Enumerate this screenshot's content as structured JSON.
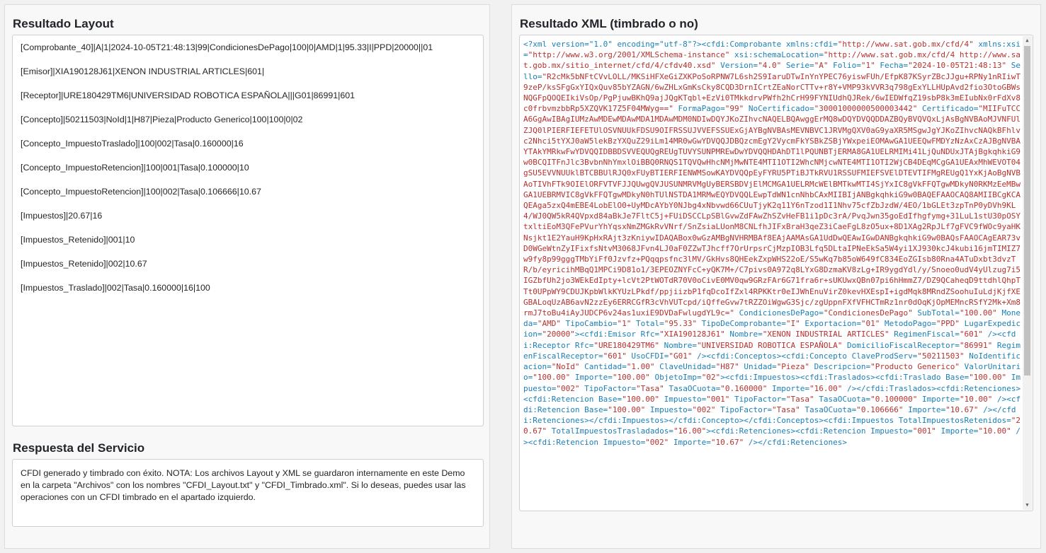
{
  "left_panel": {
    "layout_title": "Resultado Layout",
    "layout_lines": [
      "[Comprobante_40]|A|1|2024-10-05T21:48:13|99|CondicionesDePago|100|0|AMD|1|95.33|I|PPD|20000||01",
      "[Emisor]|XIA190128J61|XENON INDUSTRIAL ARTICLES|601|",
      "[Receptor]|URE180429TM6|UNIVERSIDAD ROBOTICA ESPAÑOLA|||G01|86991|601",
      "[Concepto]|50211503|NoId|1|H87|Pieza|Producto Generico|100|100|0|02",
      "[Concepto_ImpuestoTraslado]|100|002|Tasa|0.160000|16",
      "[Concepto_ImpuestoRetencion]|100|001|Tasa|0.100000|10",
      "[Concepto_ImpuestoRetencion]|100|002|Tasa|0.106666|10.67",
      "[Impuestos]|20.67|16",
      "[Impuestos_Retenido]|001|10",
      "[Impuestos_Retenido]|002|10.67",
      "[Impuestos_Traslado]|002|Tasa|0.160000|16|100"
    ],
    "service_title": "Respuesta del Servicio",
    "service_message": "CFDI generado y timbrado con éxito. NOTA: Los archivos Layout y XML se guardaron internamente en este Demo en la carpeta \"Archivos\" con los nombres \"CFDI_Layout.txt\" y \"CFDI_Timbrado.xml\". Si lo deseas, puedes usar las operaciones con un CFDI timbrado en el apartado izquierdo."
  },
  "right_panel": {
    "xml_title": "Resultado XML (timbrado o no)",
    "xml_tokens": [
      [
        "t",
        "<?xml version=\"1.0\" encoding=\"utf-8\"?><cfdi:Comprobante xmlns:cfdi="
      ],
      [
        "v",
        "\"http://www.sat.gob.mx/cfd/4\""
      ],
      [
        "t",
        " xmlns:xsi="
      ],
      [
        "v",
        "\"http://www.w3.org/2001/XMLSchema-instance\""
      ],
      [
        "t",
        " xsi:schemaLocation="
      ],
      [
        "v",
        "\"http://www.sat.gob.mx/cfd/4 http://www.sat.gob.mx/sitio_internet/cfd/4/cfdv40.xsd\""
      ],
      [
        "t",
        " Version="
      ],
      [
        "v",
        "\"4.0\""
      ],
      [
        "t",
        " Serie="
      ],
      [
        "v",
        "\"A\""
      ],
      [
        "t",
        " Folio="
      ],
      [
        "v",
        "\"1\""
      ],
      [
        "t",
        " Fecha="
      ],
      [
        "v",
        "\"2024-10-05T21:48:13\""
      ],
      [
        "t",
        " Sello="
      ],
      [
        "v",
        "\"R2cMk5bNFtCVvLOLL/MKSiHFXeGiZXKPoSoRPNW7L6sh2S9IaruDTwInYnYPEC76yiswFUh/EfpK87KSyrZBcJJgu+RPNy1nRIiwT9zeP/ksSFgGxYIQxQuv85bYZAGN/6wZHLxGmKsCky8CQD3DrnICrtZEaNorCTTv+r8Y+VMP93kVVR3q798gExYLLHUpAvd2fio3OtoGBWsNQGFpQOQEIkiVsOp/PgPjuwBKhQ9ajJQgKTqbl+EzVi0TMkkdrvPWfh2hCrH99FYNIUdhQJRek/6wIEDWfqZ19sbP8k3mEIubNx0rFdXv8c0frbvmzbbRp5XZQVK17Z5F04MWyg==\""
      ],
      [
        "t",
        " FormaPago="
      ],
      [
        "v",
        "\"99\""
      ],
      [
        "t",
        " NoCertificado="
      ],
      [
        "v",
        "\"30001000000500003442\""
      ],
      [
        "t",
        " Certificado="
      ],
      [
        "v",
        "\"MIIFuTCCA6GgAwIBAgIUMzAwMDEwMDAwMDA1MDAwMDM0NDIwDQYJKoZIhvcNAQELBQAwggErMQ8wDQYDVQQDDAZBQyBVQVQxLjAsBgNVBAoMJVNFUlZJQ0lPIERFIEFETUlOSVNUUkFDSU9OIFRSSUJVVEFSSUExGjAYBgNVBAsMEVNBVC1JRVMgQXV0aG9yaXR5MSgwJgYJKoZIhvcNAQkBFhlvc2Nhci5tYXJ0aW5lekBzYXQuZ29iLm14MR0wGwYDVQQJDBQzcmEgY2VycmFkYSBkZSBjYWxpeiEOMAwGA1UEEQwFMDYzNzAxCzAJBgNVBAYTAkYMRkwFwYDVQQIDBBDSVVEQUQgREUgTUVYSUNPMREwDwYDVQQHDAhDT1lPQUNBTjERMA8GA1UELRMIMi41LjQuNDUxJTAjBgkqhkiG9w0BCQITFnJlc3BvbnNhYmxlOiBBQ0RNQS1TQVQwHhcNMjMwNTE4MTI1OTI2WhcNMjcwNTE4MTI1OTI2WjCB4DEqMCgGA1UEAxMhWEVOT04gSU5EVVNUUklBTCBBUlRJQ0xFUyBTIERFIENWMSowKAYDVQQpEyFYRU5PTiBJTkRVU1RSSUFMIEFSVElDTEVTIFMgREUgQ1YxKjAoBgNVBAoTIVhFTk9OIElORFVTVFJJQUwgQVJUSUNMRVMgUyBERSBDVjElMCMGA1UELRMcWElBMTkwMTI4SjYxIC8gVkFFQTgwMDkyN0RKMzEeMBwGA1UEBRMVIC8gVkFFQTgwMDkyN0hTUlNSTDA1MRMwEQYDVQQLEwpTdWN1cnNhbCAxMIIBIjANBgkqhkiG9w0BAQEFAAOCAQ8AMIIBCgKCAQEAga5zxQ4mEBE4LobElO0+UyMDcAYbY0NJbg4xNbvwd66CUuTjyK2q11Y6nTzod1I1Nhv75cfZbJzdW/4EO/1bGLEt3zpTnP0yDVh9KL4/WJ0QW5kR4QVpxd84aBkJe7FltC5j+FUiDSCCLpSBlGvwZdFAwZhSZvHeFB1i1pDc3rA/PvqJwn35goEdIfhgfymg+31LuL1stU30pOSYtxltiEoM3QFePVurYhYqsxNmZMGkRvVNrf/SnZsiaLUonM8CNLfhJIFxBraH3qeZ3iCaeFgL8zO5ux+8D1XAg2RpJLf7gFVC9fWOc9yaHKNsjkt1E2YauH9KpHxRAjt3zKniywIDAQABox0wGzAMBgNVHRMBAf8EAjAAMAsGA1UdDwQEAwIGwDANBgkqhkiG9w0BAQsFAAOCAgEAR73vD0WGeWtnZyIFixfsNtvM3068JFvn4LJ0aF0ZZwTJhcff7OrUrpsrCjMzpIOB3Lfq5DLtaIPNeEkSa5W4yi1XJ930kcJ4kubi16jmTIMIZ7w9fy8p99gggTMbYiFf0Jzvfz+PQqqpsfnc3lMV/GkHvs8QHEekZxpWHS22oE/S5wKq7b85oW649fC834EoZGIsb80Rna4ATuDxbt3dvzTR/b/eyricihMBqQ1MPCi9D81o1/3EPEOZNYFcC+yQK7M+/C7pivs0A972q8LYxG8DzmaKV8zLg+IR9ygdYdl/y/Snoeo0udV4yUlzug7i5IGZbfUh2jo3WEkEdIpty+lcVt2PtWOTdR70V0oCivE0MV0qw9GRzFAr6G71fra6r+sUKUwxQBn07pi6hHmmZ7/DZ9QCaheqD9ttdhlQhpTTt0UPpWY9CDUJKpbWlkKYUzLPkdf/ppjiizbP1fqDcoIfZxl4RPKKtr0eIJWhEnuVirZ0kevHXEspI+igdMqk8MRndZSoohuIuLdjKjfXEGBALoqUzAB6avN2zzEy6ERRCGfR3cVhVUTcpd/iQffeGvw7tRZZOiWgwG3Sjc/zgUppnFXfVFHCTmRz1nr0dOqKjOpMEMncRSfY2Mk+Xm8rmJ7toBu4iAyJUDCP6v24as1uxiE9DVDaFwlugdYL9c=\""
      ],
      [
        "t",
        " CondicionesDePago="
      ],
      [
        "v",
        "\"CondicionesDePago\""
      ],
      [
        "t",
        " SubTotal="
      ],
      [
        "v",
        "\"100.00\""
      ],
      [
        "t",
        " Moneda="
      ],
      [
        "v",
        "\"AMD\""
      ],
      [
        "t",
        " TipoCambio="
      ],
      [
        "v",
        "\"1\""
      ],
      [
        "t",
        " Total="
      ],
      [
        "v",
        "\"95.33\""
      ],
      [
        "t",
        " TipoDeComprobante="
      ],
      [
        "v",
        "\"I\""
      ],
      [
        "t",
        " Exportacion="
      ],
      [
        "v",
        "\"01\""
      ],
      [
        "t",
        " MetodoPago="
      ],
      [
        "v",
        "\"PPD\""
      ],
      [
        "t",
        " LugarExpedicion="
      ],
      [
        "v",
        "\"20000\""
      ],
      [
        "t",
        "><cfdi:Emisor Rfc="
      ],
      [
        "v",
        "\"XIA190128J61\""
      ],
      [
        "t",
        " Nombre="
      ],
      [
        "v",
        "\"XENON INDUSTRIAL ARTICLES\""
      ],
      [
        "t",
        " RegimenFiscal="
      ],
      [
        "v",
        "\"601\""
      ],
      [
        "t",
        " /><cfdi:Receptor Rfc="
      ],
      [
        "v",
        "\"URE180429TM6\""
      ],
      [
        "t",
        " Nombre="
      ],
      [
        "v",
        "\"UNIVERSIDAD ROBOTICA ESPAÑOLA\""
      ],
      [
        "t",
        " DomicilioFiscalReceptor="
      ],
      [
        "v",
        "\"86991\""
      ],
      [
        "t",
        " RegimenFiscalReceptor="
      ],
      [
        "v",
        "\"601\""
      ],
      [
        "t",
        " UsoCFDI="
      ],
      [
        "v",
        "\"G01\""
      ],
      [
        "t",
        " /><cfdi:Conceptos><cfdi:Concepto ClaveProdServ="
      ],
      [
        "v",
        "\"50211503\""
      ],
      [
        "t",
        " NoIdentificacion="
      ],
      [
        "v",
        "\"NoId\""
      ],
      [
        "t",
        " Cantidad="
      ],
      [
        "v",
        "\"1.00\""
      ],
      [
        "t",
        " ClaveUnidad="
      ],
      [
        "v",
        "\"H87\""
      ],
      [
        "t",
        " Unidad="
      ],
      [
        "v",
        "\"Pieza\""
      ],
      [
        "t",
        " Descripcion="
      ],
      [
        "v",
        "\"Producto Generico\""
      ],
      [
        "t",
        " ValorUnitario="
      ],
      [
        "v",
        "\"100.00\""
      ],
      [
        "t",
        " Importe="
      ],
      [
        "v",
        "\"100.00\""
      ],
      [
        "t",
        " ObjetoImp="
      ],
      [
        "v",
        "\"02\""
      ],
      [
        "t",
        "><cfdi:Impuestos><cfdi:Traslados><cfdi:Traslado Base="
      ],
      [
        "v",
        "\"100.00\""
      ],
      [
        "t",
        " Impuesto="
      ],
      [
        "v",
        "\"002\""
      ],
      [
        "t",
        " TipoFactor="
      ],
      [
        "v",
        "\"Tasa\""
      ],
      [
        "t",
        " TasaOCuota="
      ],
      [
        "v",
        "\"0.160000\""
      ],
      [
        "t",
        " Importe="
      ],
      [
        "v",
        "\"16.00\""
      ],
      [
        "t",
        " /></cfdi:Traslados><cfdi:Retenciones><cfdi:Retencion Base="
      ],
      [
        "v",
        "\"100.00\""
      ],
      [
        "t",
        " Impuesto="
      ],
      [
        "v",
        "\"001\""
      ],
      [
        "t",
        " TipoFactor="
      ],
      [
        "v",
        "\"Tasa\""
      ],
      [
        "t",
        " TasaOCuota="
      ],
      [
        "v",
        "\"0.100000\""
      ],
      [
        "t",
        " Importe="
      ],
      [
        "v",
        "\"10.00\""
      ],
      [
        "t",
        " /><cfdi:Retencion Base="
      ],
      [
        "v",
        "\"100.00\""
      ],
      [
        "t",
        " Impuesto="
      ],
      [
        "v",
        "\"002\""
      ],
      [
        "t",
        " TipoFactor="
      ],
      [
        "v",
        "\"Tasa\""
      ],
      [
        "t",
        " TasaOCuota="
      ],
      [
        "v",
        "\"0.106666\""
      ],
      [
        "t",
        " Importe="
      ],
      [
        "v",
        "\"10.67\""
      ],
      [
        "t",
        " /></cfdi:Retenciones></cfdi:Impuestos></cfdi:Concepto></cfdi:Conceptos><cfdi:Impuestos TotalImpuestosRetenidos="
      ],
      [
        "v",
        "\"20.67\""
      ],
      [
        "t",
        " TotalImpuestosTrasladados="
      ],
      [
        "v",
        "\"16.00\""
      ],
      [
        "t",
        "><cfdi:Retenciones><cfdi:Retencion Impuesto="
      ],
      [
        "v",
        "\"001\""
      ],
      [
        "t",
        " Importe="
      ],
      [
        "v",
        "\"10.00\""
      ],
      [
        "t",
        " /><cfdi:Retencion Impuesto="
      ],
      [
        "v",
        "\"002\""
      ],
      [
        "t",
        " Importe="
      ],
      [
        "v",
        "\"10.67\""
      ],
      [
        "t",
        " /></cfdi:Retenciones>"
      ]
    ],
    "scroll_up_glyph": "▲",
    "scroll_down_glyph": "▼"
  }
}
